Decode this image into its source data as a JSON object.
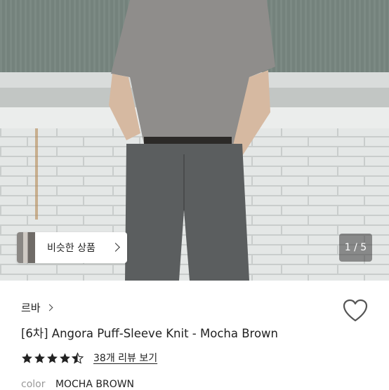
{
  "gallery": {
    "similar_label": "비슷한 상품",
    "counter": "1 / 5"
  },
  "product": {
    "shop_name": "르바",
    "title": "[6차] Angora Puff-Sleeve Knit - Mocha Brown",
    "rating": 4.5,
    "review_link": "38개 리뷰 보기",
    "color_label": "color",
    "color_value": "MOCHA BROWN"
  },
  "icons": [
    "chevron-right-icon",
    "heart-icon",
    "star-icon",
    "half-star-icon"
  ],
  "colors": {
    "star": "#222222",
    "counter_bg": "#3c3c3c"
  }
}
